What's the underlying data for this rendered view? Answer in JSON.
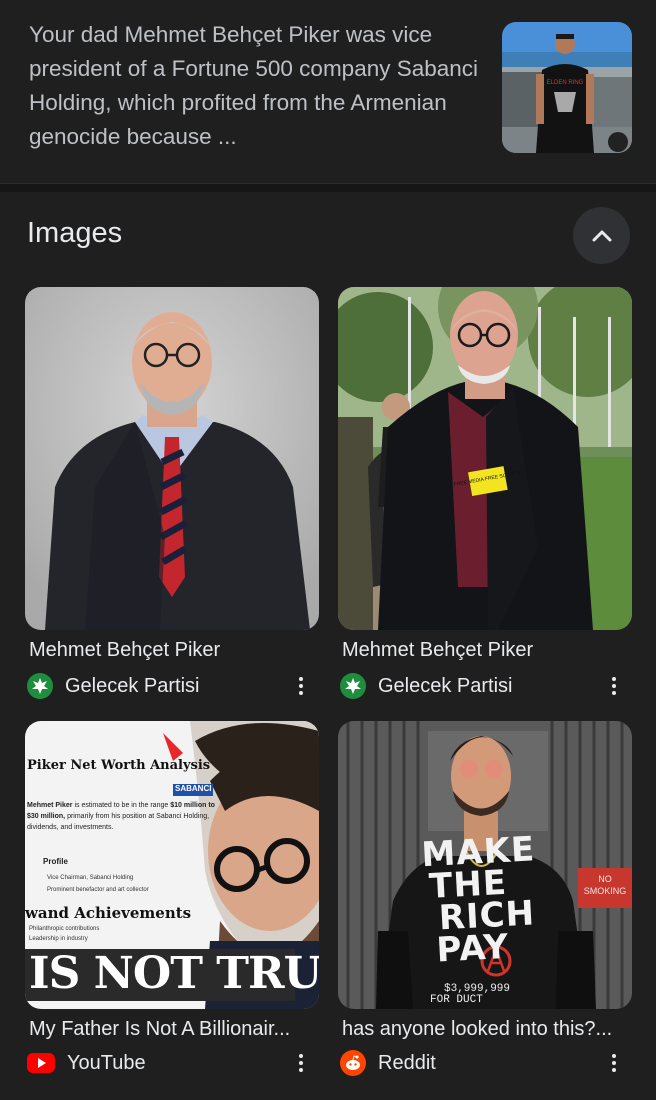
{
  "snippet": {
    "text": "Your dad Mehmet Behçet Piker was vice president of a Fortune 500 company Sabanci Holding, which profited from the Armenian genocide because ...",
    "thumb_shirt_text": "ELDEN RING"
  },
  "images_section": {
    "title": "Images",
    "collapse_icon": "chevron-up-icon"
  },
  "cards": [
    {
      "title": "Mehmet Behçet Piker",
      "source": "Gelecek Partisi",
      "source_icon": "gelecek-leaf-icon"
    },
    {
      "title": "Mehmet Behçet Piker",
      "source": "Gelecek Partisi",
      "source_icon": "gelecek-leaf-icon",
      "badge_text": "FREE MEDIA FREE SOCIETY"
    },
    {
      "title": "My Father Is Not A Billionair...",
      "source": "YouTube",
      "source_icon": "youtube-icon",
      "thumb": {
        "heading": "Piker Net Worth Analysis",
        "brand": "SABANCI",
        "estimate_name": "Mehmet Piker",
        "estimate_line": " is estimated to be in the range",
        "estimate_range": "$10 million to $30 million,",
        "estimate_rest": " primarily from his position at Sabanci Holding, dividends, and investments.",
        "profile_label": "Profile",
        "profile_items": [
          "Vice Chairman, Sabanci Holding",
          "Prominent benefactor and art collector"
        ],
        "achievements_title": "wand Achievements",
        "achievement_items": [
          "Philanthropic contributions",
          "Leadership in industry"
        ],
        "banner": "IS NOT TRUE"
      }
    },
    {
      "title": "has anyone looked into this?...",
      "source": "Reddit",
      "source_icon": "reddit-icon",
      "thumb": {
        "shirt_lines": [
          "MAKE",
          "THE",
          "RICH",
          "PAY"
        ],
        "shirt_small": "$3,999,999",
        "shirt_bottom": "FOR DUCT",
        "sign_lines": [
          "NO",
          "SMOKING"
        ]
      }
    }
  ],
  "colors": {
    "background": "#1f1f1f",
    "text_primary": "#e8eaed",
    "text_secondary": "#bdc1c6",
    "youtube_red": "#ff0000",
    "reddit_orange": "#ff4500",
    "gelecek_green": "#1e8e3e"
  }
}
